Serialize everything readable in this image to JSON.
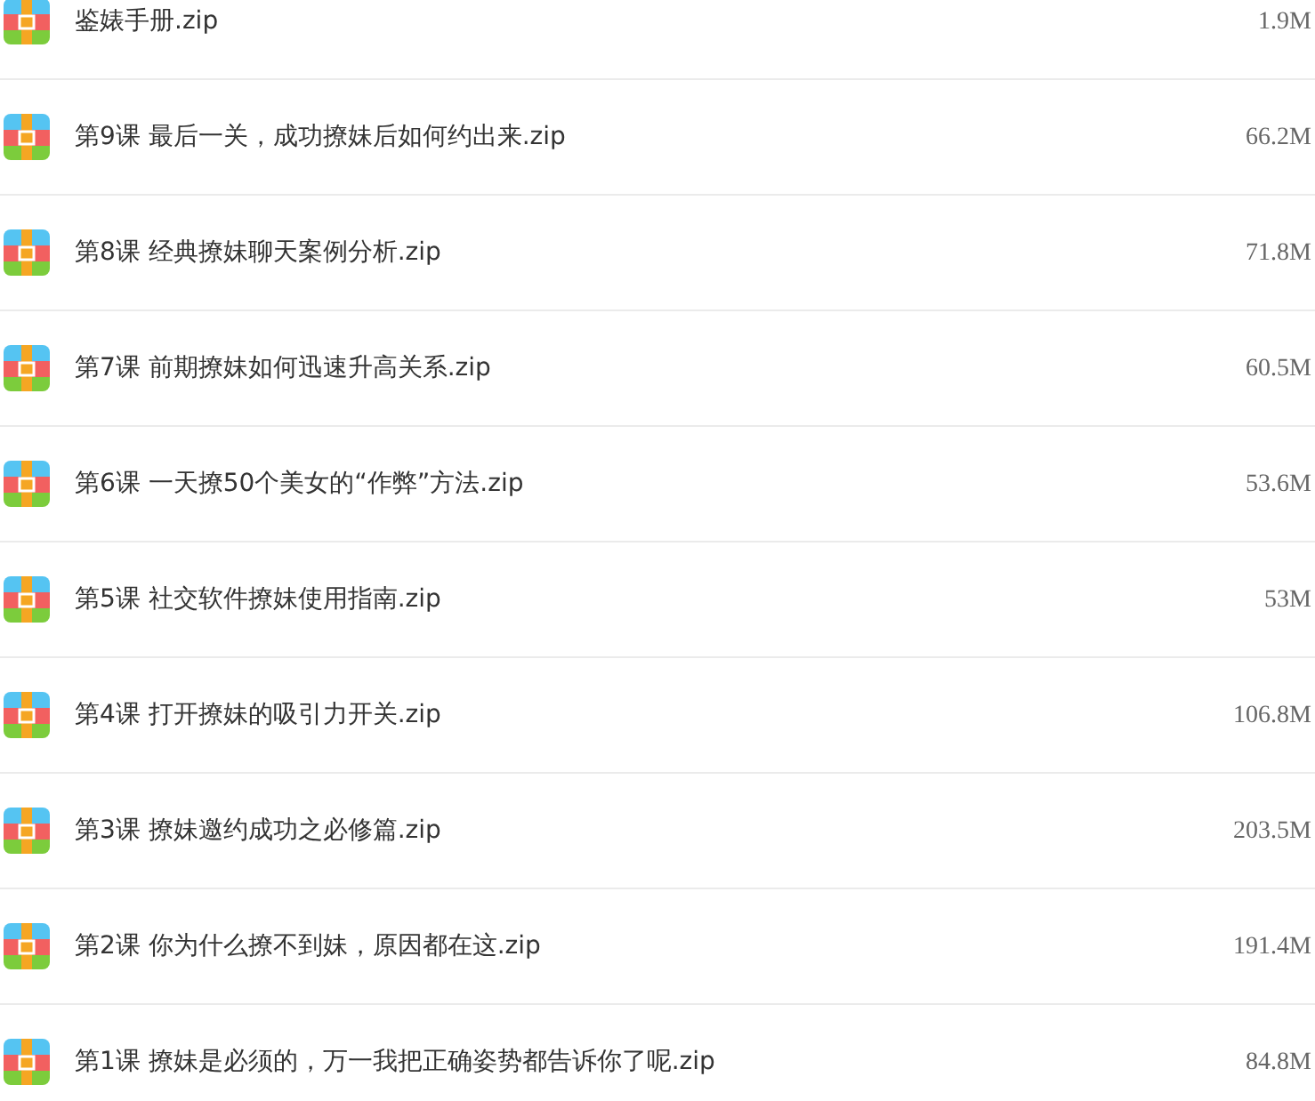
{
  "files": [
    {
      "name": "鉴婊手册.zip",
      "size": "1.9M"
    },
    {
      "name": "第9课 最后一关，成功撩妹后如何约出来.zip",
      "size": "66.2M"
    },
    {
      "name": "第8课 经典撩妹聊天案例分析.zip",
      "size": "71.8M"
    },
    {
      "name": "第7课 前期撩妹如何迅速升高关系.zip",
      "size": "60.5M"
    },
    {
      "name": "第6课 一天撩50个美女的“作弊”方法.zip",
      "size": "53.6M"
    },
    {
      "name": "第5课 社交软件撩妹使用指南.zip",
      "size": "53M"
    },
    {
      "name": "第4课 打开撩妹的吸引力开关.zip",
      "size": "106.8M"
    },
    {
      "name": "第3课 撩妹邀约成功之必修篇.zip",
      "size": "203.5M"
    },
    {
      "name": "第2课 你为什么撩不到妹，原因都在这.zip",
      "size": "191.4M"
    },
    {
      "name": "第1课 撩妹是必须的，万一我把正确姿势都告诉你了呢.zip",
      "size": "84.8M"
    }
  ]
}
